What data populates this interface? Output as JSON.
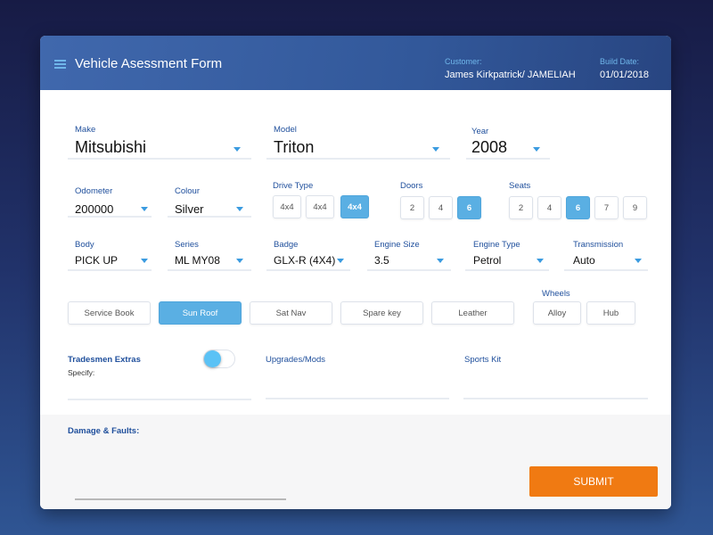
{
  "header": {
    "title": "Vehicle Asessment Form",
    "customer_label": "Customer:",
    "customer_value": "James Kirkpatrick/ JAMELIAH",
    "build_date_label": "Build Date:",
    "build_date_value": "01/01/2018"
  },
  "fields": {
    "make": {
      "label": "Make",
      "value": "Mitsubishi"
    },
    "model": {
      "label": "Model",
      "value": "Triton"
    },
    "year": {
      "label": "Year",
      "value": "2008"
    },
    "odometer": {
      "label": "Odometer",
      "value": "200000"
    },
    "colour": {
      "label": "Colour",
      "value": "Silver"
    },
    "body": {
      "label": "Body",
      "value": "PICK UP"
    },
    "series": {
      "label": "Series",
      "value": "ML MY08"
    },
    "badge": {
      "label": "Badge",
      "value": "GLX-R (4X4)"
    },
    "engine_size": {
      "label": "Engine Size",
      "value": "3.5"
    },
    "engine_type": {
      "label": "Engine Type",
      "value": "Petrol"
    },
    "transmission": {
      "label": "Transmission",
      "value": "Auto"
    }
  },
  "drive_type": {
    "label": "Drive Type",
    "options": [
      "4x4",
      "4x4",
      "4x4"
    ],
    "selected": 2
  },
  "doors": {
    "label": "Doors",
    "options": [
      "2",
      "4",
      "6"
    ],
    "selected": 2
  },
  "seats": {
    "label": "Seats",
    "options": [
      "2",
      "4",
      "6",
      "7",
      "9"
    ],
    "selected": 2
  },
  "extras": {
    "options": [
      "Service Book",
      "Sun Roof",
      "Sat Nav",
      "Spare key",
      "Leather"
    ],
    "selected": 1
  },
  "wheels": {
    "label": "Wheels",
    "options": [
      "Alloy",
      "Hub"
    ]
  },
  "tradesmen": {
    "label": "Tradesmen Extras",
    "specify": "Specify:",
    "toggle_on": true
  },
  "upgrades": {
    "label": "Upgrades/Mods"
  },
  "sports_kit": {
    "label": "Sports Kit"
  },
  "damage": {
    "label": "Damage & Faults:"
  },
  "submit_label": "SUBMIT",
  "colors": {
    "accent": "#5aafe3",
    "submit": "#f07a12",
    "label": "#1f4f9c"
  }
}
